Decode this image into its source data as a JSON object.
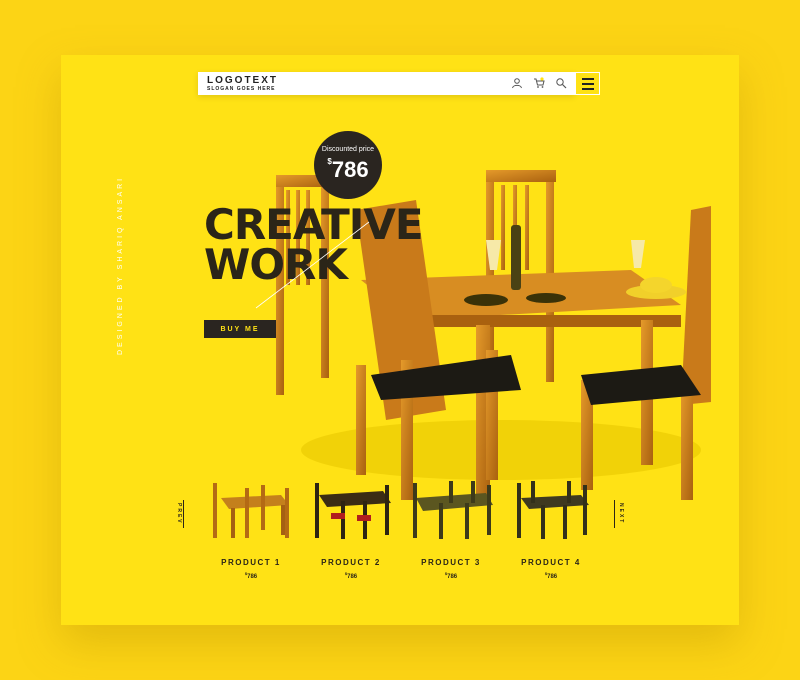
{
  "brand": {
    "logo_text": "LOGOTEXT",
    "slogan": "SLOGAN GOES HERE"
  },
  "nav": {
    "icons": [
      "user-icon",
      "cart-icon",
      "search-icon",
      "menu-icon"
    ]
  },
  "side_text": "DESIGNED BY SHARIQ ANSARI",
  "hero": {
    "headline_line1": "CREATIVE",
    "headline_line2": "WORK",
    "price_label": "Discounted price",
    "price_currency": "$",
    "price_value": "786",
    "cta_label": "BUY ME"
  },
  "carousel": {
    "prev_label": "PREV",
    "next_label": "NEXT",
    "products": [
      {
        "name": "PRODUCT 1",
        "currency": "$",
        "price": "786"
      },
      {
        "name": "PRODUCT 2",
        "currency": "$",
        "price": "786"
      },
      {
        "name": "PRODUCT 3",
        "currency": "$",
        "price": "786"
      },
      {
        "name": "PRODUCT 4",
        "currency": "$",
        "price": "786"
      }
    ]
  },
  "colors": {
    "page_bg": "#FCD415",
    "card_bg": "#FFE215",
    "dark": "#2A2520",
    "accent_text": "#FFE215"
  }
}
